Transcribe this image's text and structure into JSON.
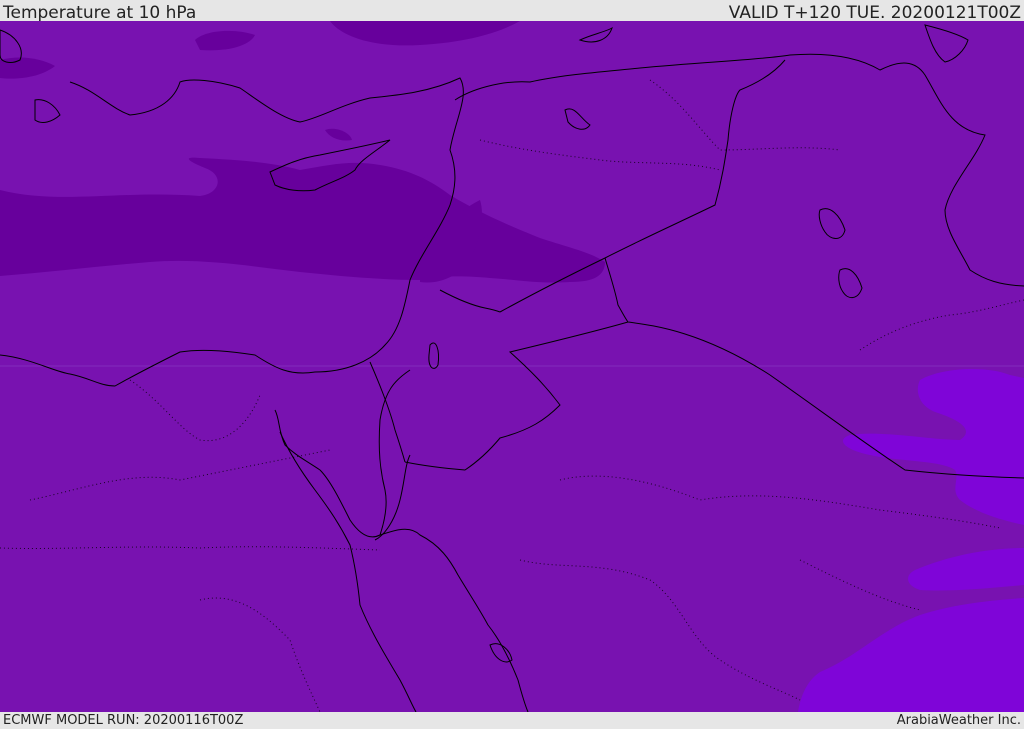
{
  "header": {
    "title": "Temperature at 10 hPa",
    "valid_time": "VALID T+120 TUE. 20200121T00Z"
  },
  "footer": {
    "model_run": "ECMWF MODEL RUN: 20200116T00Z",
    "credit": "ArabiaWeather Inc."
  },
  "map": {
    "colors": {
      "base": "#7812b0",
      "dark_band": "#67009c",
      "warm_patch": "#7f05d8",
      "coastline": "#000000",
      "border": "#000000"
    }
  }
}
